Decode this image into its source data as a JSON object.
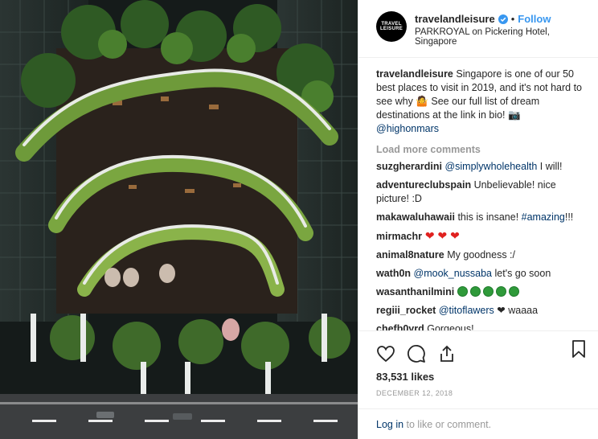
{
  "header": {
    "avatar_text_1": "TRAVEL",
    "avatar_text_2": "LEISURE",
    "username": "travelandleisure",
    "separator": "•",
    "follow": "Follow",
    "location": "PARKROYAL on Pickering Hotel, Singapore"
  },
  "caption": {
    "username": "travelandleisure",
    "text": " Singapore is one of our 50 best places to visit in 2019, and it's not hard to see why 🤷 See our full list of dream destinations at the link in bio! 📷 ",
    "mention": "@highonmars"
  },
  "load_more": "Load more comments",
  "comments": [
    {
      "user": "suzgherardini",
      "mention": "@simplywholehealth",
      "text": " I will!"
    },
    {
      "user": "adventureclubspain",
      "text": " Unbelievable! nice picture! :D"
    },
    {
      "user": "makawaluhawaii",
      "text": " this is insane! ",
      "tag": "#amazing",
      "tail": "!!!"
    },
    {
      "user": "mirmachr",
      "text": " ❤ ❤ ❤"
    },
    {
      "user": "animal8nature",
      "text": " My goodness :/"
    },
    {
      "user": "wath0n",
      "mention": "@mook_nussaba",
      "text": " let's go soon"
    },
    {
      "user": "wasanthanilmini",
      "trees": 5
    },
    {
      "user": "regiii_rocket",
      "mention": "@titoflawers",
      "text": " ❤ waaaa"
    },
    {
      "user": "chefb0yrd",
      "text": " Gorgeous!"
    }
  ],
  "likes": "83,531 likes",
  "date": "December 12, 2018",
  "login": {
    "link": "Log in",
    "text": " to like or comment."
  },
  "icons": {
    "like": "heart-outline-icon",
    "comment": "comment-bubble-icon",
    "share": "share-icon",
    "save": "bookmark-icon",
    "verified": "verified-badge-icon"
  },
  "colors": {
    "link": "#3897f0",
    "mention": "#003569",
    "heart": "#e0211f",
    "muted": "#999999"
  }
}
